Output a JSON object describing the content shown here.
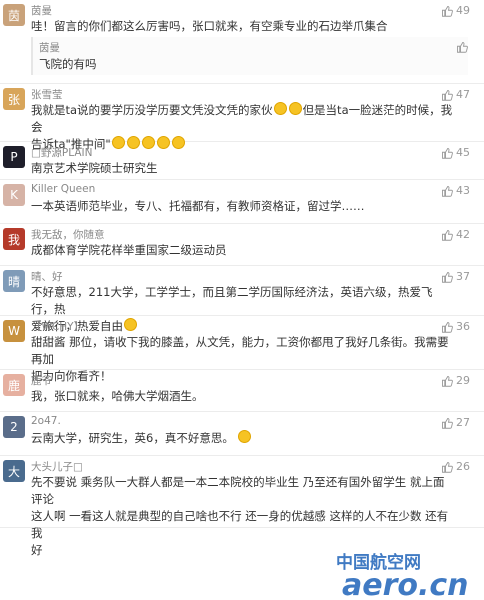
{
  "comments": [
    {
      "user": "茵曼",
      "text": "哇！留言的你们都这么厉害吗，张口就来，有空乘专业的石边举爪集合",
      "likes": "49",
      "avatar_color": "#c9a27a",
      "avatar_glyph": "茵",
      "reply": {
        "user": "茵曼",
        "text": "飞院的有吗",
        "likes": ""
      }
    },
    {
      "user": "张雪莹",
      "text": "我就是ta说的要学历没学历要文凭没文凭的家伙",
      "text2": "但是当ta一脸迷茫的时候，我会",
      "text3": "告诉ta\"推中间\"",
      "likes": "47",
      "avatar_color": "#d8a55a",
      "avatar_glyph": "张"
    },
    {
      "user": "□野源PLAIN",
      "text": "南京艺术学院硕士研究生",
      "likes": "45",
      "avatar_color": "#1e1e2a",
      "avatar_glyph": "P"
    },
    {
      "user": "Killer Queen",
      "text": "一本英语师范毕业，专八、托福都有，有教师资格证，留过学……",
      "likes": "43",
      "avatar_color": "#d6b3a6",
      "avatar_glyph": "K"
    },
    {
      "user": "我无敌，你随意",
      "text": "成都体育学院花样举重国家二级运动员",
      "likes": "42",
      "avatar_color": "#b53a2a",
      "avatar_glyph": "我"
    },
    {
      "user": "晴、好",
      "text": "不好意思，211大学，工学学士，而且第二学历国际经济法，英语六级，热爱飞行，热",
      "text2": "爱旅行，热爱自由",
      "likes": "37",
      "avatar_color": "#7f9bb8",
      "avatar_glyph": "晴"
    },
    {
      "user": "【WCHY】",
      "text": "甜甜酱 那位，请收下我的膝盖，从文凭，能力，工资你都甩了我好几条街。我需要再加",
      "text2": "把力向你看齐！",
      "likes": "36",
      "avatar_color": "#c7913e",
      "avatar_glyph": "W"
    },
    {
      "user": "鹿爷",
      "text": "我，张口就来，哈佛大学烟酒生。",
      "likes": "29",
      "avatar_color": "#e6b0a0",
      "avatar_glyph": "鹿"
    },
    {
      "user": "2o47.",
      "text": "云南大学，研究生，英6，真不好意思。",
      "likes": "27",
      "avatar_color": "#5a6d8a",
      "avatar_glyph": "2"
    },
    {
      "user": "大头儿子□",
      "text": "先不要说 乘务队一大群人都是一本二本院校的毕业生 乃至还有国外留学生 就上面评论",
      "text2": "这人啊 一看这人就是典型的自己啥也不行 还一身的优越感 这样的人不在少数 还有 我",
      "text3": "好",
      "likes": "26",
      "avatar_color": "#4a6b8e",
      "avatar_glyph": "大"
    }
  ],
  "watermark": {
    "line1": "中国航空网",
    "line2": "aero.cn"
  },
  "colors": {
    "like": "#999999",
    "username": "#888888",
    "text": "#333333",
    "watermark": "#1f63b8"
  }
}
